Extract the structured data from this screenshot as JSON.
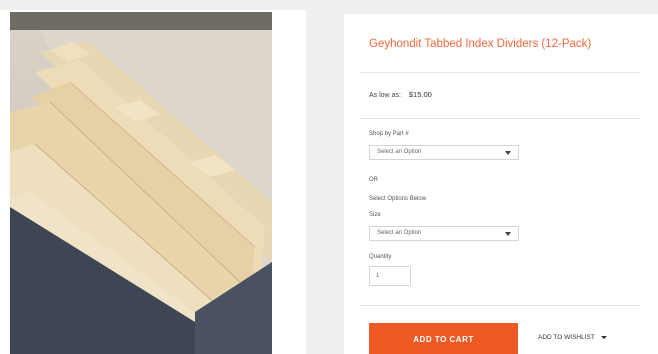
{
  "product": {
    "title": "Geyhondit Tabbed Index Dividers (12-Pack)",
    "price_label": "As low as:",
    "price": "$15.00"
  },
  "options": {
    "part_label": "Shop by Part #",
    "part_select": "Select an Option",
    "or_label": "OR",
    "select_below_label": "Select Options Below",
    "size_label": "Size",
    "size_select": "Select an Option",
    "quantity_label": "Quantity",
    "quantity_value": "1"
  },
  "actions": {
    "add_to_cart": "ADD TO CART",
    "add_to_wishlist": "ADD TO WISHLIST"
  },
  "colors": {
    "accent": "#ef5a24",
    "title": "#ef6a3c"
  }
}
